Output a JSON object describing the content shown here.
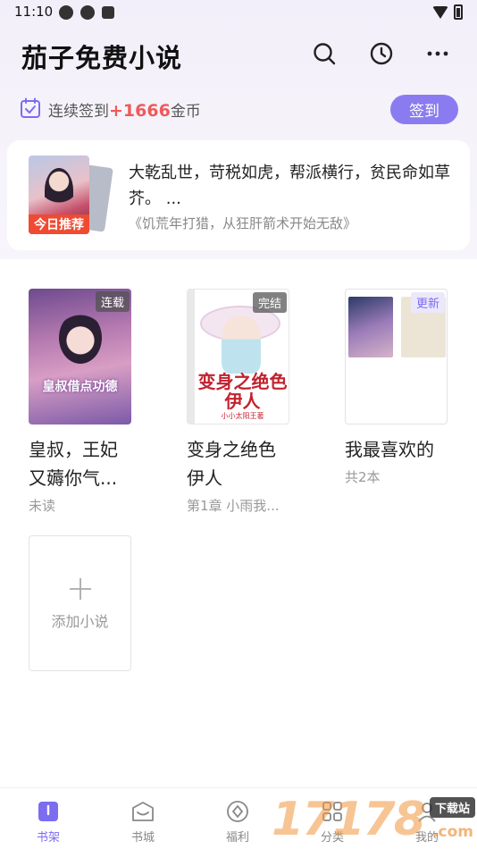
{
  "status_bar": {
    "time": "11:10"
  },
  "header": {
    "title": "茄子免费小说"
  },
  "checkin": {
    "prefix": "连续签到",
    "coins": "+1666",
    "suffix": "金币",
    "button": "签到"
  },
  "recommendation": {
    "badge": "今日推荐",
    "description": "大乾乱世，苛税如虎，帮派横行，贫民命如草芥。 ...",
    "source": "《饥荒年打猎，从狂肝箭术开始无敌》"
  },
  "books": [
    {
      "title": "皇叔，王妃又薅你气...",
      "subtitle": "未读",
      "tag": "连载",
      "cover_text": "皇叔借点功德"
    },
    {
      "title": "变身之绝色伊人",
      "subtitle": "第1章 小雨我...",
      "tag": "完结",
      "cover_text": "变身之绝色伊人",
      "cover_author": "小小太阳王著"
    },
    {
      "title": "我最喜欢的",
      "subtitle": "共2本",
      "tag": "更新"
    }
  ],
  "add_novel": {
    "label": "添加小说"
  },
  "bottom_nav": [
    {
      "label": "书架",
      "icon": "bookshelf-icon"
    },
    {
      "label": "书城",
      "icon": "bookstore-icon"
    },
    {
      "label": "福利",
      "icon": "welfare-icon"
    },
    {
      "label": "分类",
      "icon": "category-icon"
    },
    {
      "label": "我的",
      "icon": "profile-icon"
    }
  ],
  "watermark": {
    "digits": "17178",
    "tag": "下载站",
    "domain": ".com"
  },
  "colors": {
    "accent": "#8a7cf0",
    "badge": "#f04a32",
    "coins": "#ee5a5a"
  }
}
